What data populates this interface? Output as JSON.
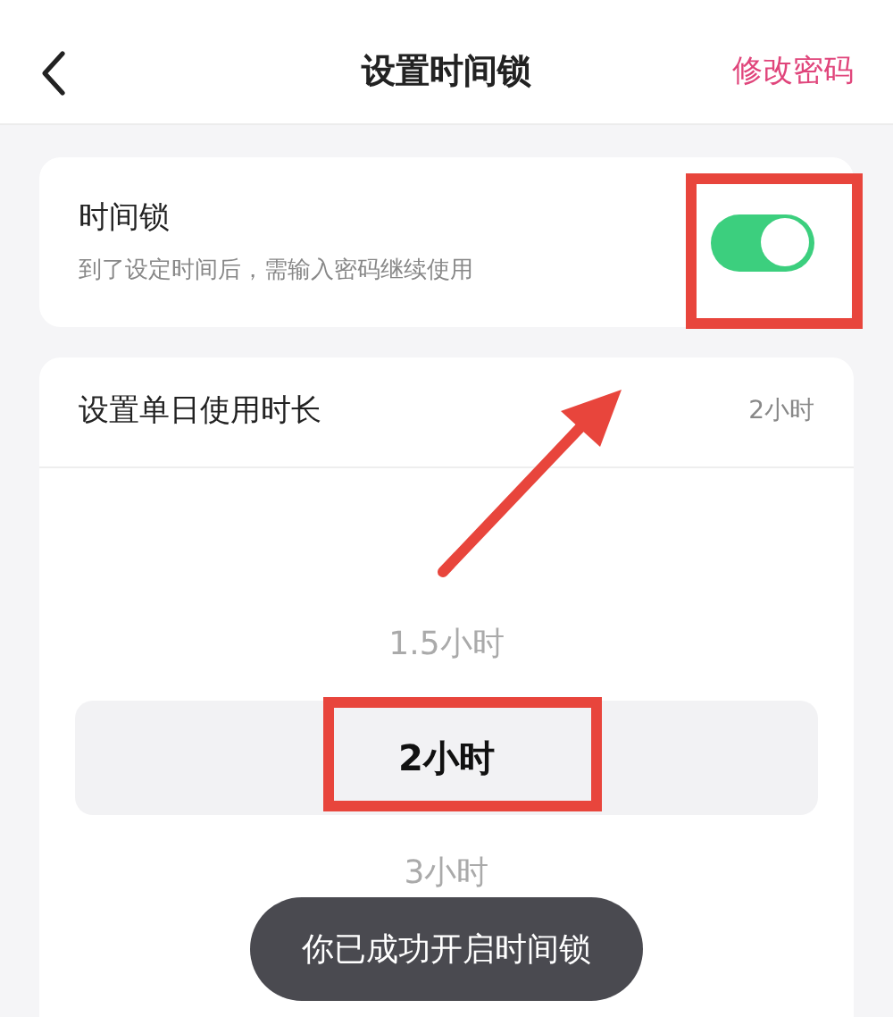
{
  "nav": {
    "title": "设置时间锁",
    "action": "修改密码"
  },
  "time_lock": {
    "title": "时间锁",
    "subtitle": "到了设定时间后，需输入密码继续使用",
    "on": true
  },
  "duration": {
    "label": "设置单日使用时长",
    "value": "2小时",
    "options": [
      {
        "label": "1.5小时",
        "selected": false
      },
      {
        "label": "2小时",
        "selected": true
      },
      {
        "label": "3小时",
        "selected": false
      }
    ]
  },
  "toast": "你已成功开启时间锁"
}
